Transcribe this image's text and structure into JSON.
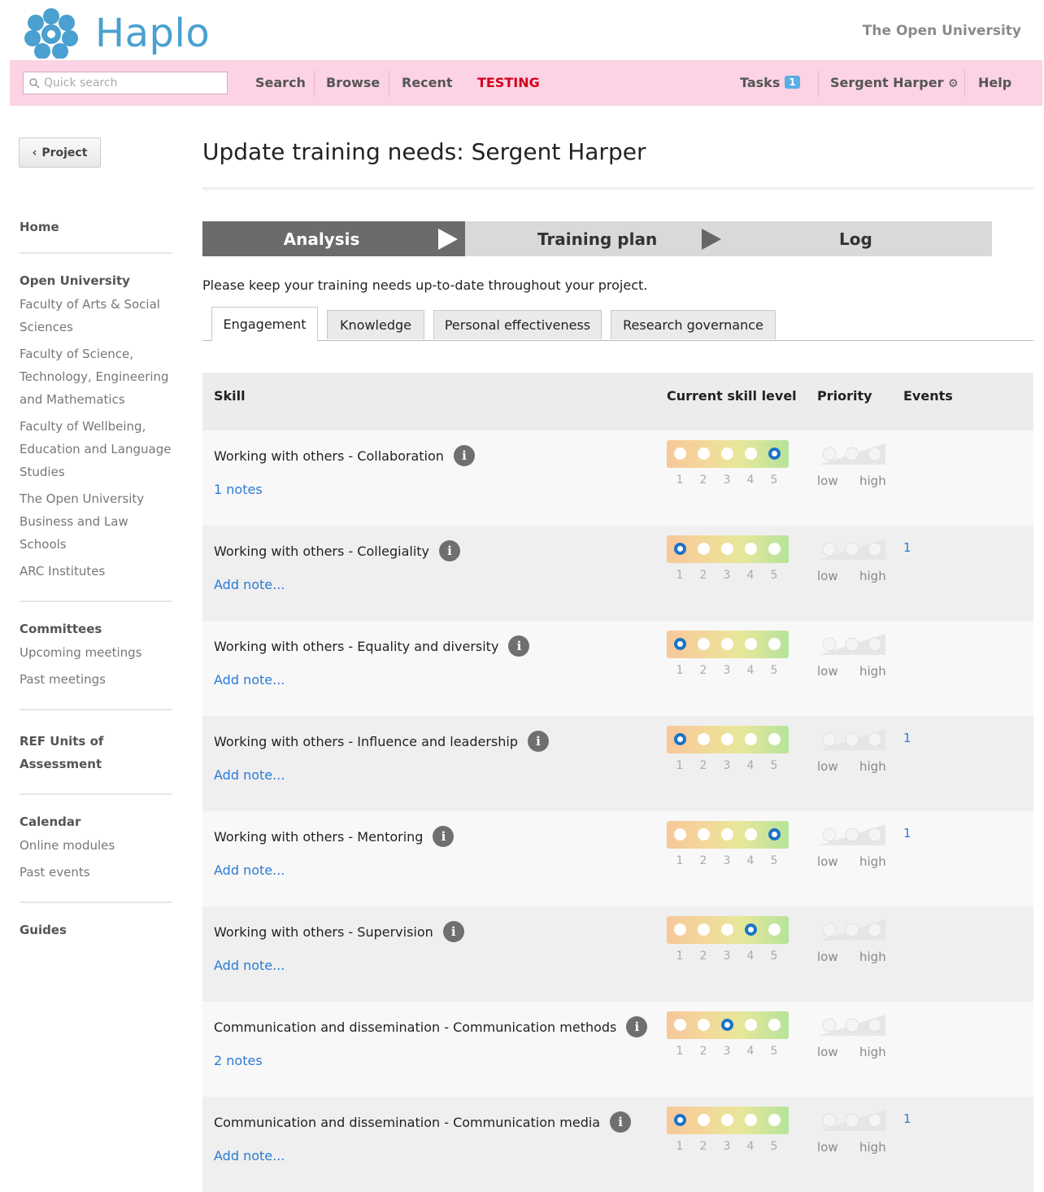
{
  "header": {
    "brand": "Haplo",
    "organisation": "The Open University"
  },
  "nav": {
    "search_placeholder": "Quick search",
    "links": [
      "Search",
      "Browse",
      "Recent",
      "TESTING"
    ],
    "tasks_label": "Tasks",
    "tasks_count": "1",
    "user": "Sergent Harper",
    "help": "Help"
  },
  "sidebar": {
    "back_label": "Project",
    "home": "Home",
    "groups": [
      {
        "heading": "Open University",
        "items": [
          "Faculty of Arts & Social Sciences",
          "Faculty of Science, Technology, Engineering and Mathematics",
          "Faculty of Wellbeing, Education and Language Studies",
          "The Open University Business and Law Schools",
          "ARC Institutes"
        ]
      },
      {
        "heading": "Committees",
        "items": [
          "Upcoming meetings",
          "Past meetings"
        ]
      },
      {
        "heading": "REF Units of Assessment",
        "items": []
      },
      {
        "heading": "Calendar",
        "items": [
          "Online modules",
          "Past events"
        ]
      }
    ],
    "guides": "Guides"
  },
  "main": {
    "title": "Update training needs: Sergent Harper",
    "steps": [
      "Analysis",
      "Training plan",
      "Log"
    ],
    "intro": "Please keep your training needs up-to-date throughout your project.",
    "tabs": [
      "Engagement",
      "Knowledge",
      "Personal effectiveness",
      "Research governance"
    ],
    "table": {
      "headers": {
        "skill": "Skill",
        "level": "Current skill level",
        "priority": "Priority",
        "events": "Events"
      },
      "level_numbers": [
        "1",
        "2",
        "3",
        "4",
        "5"
      ],
      "priority_low": "low",
      "priority_high": "high",
      "rows": [
        {
          "skill": "Working with others - Collaboration",
          "note": "1 notes",
          "level": 5,
          "events": ""
        },
        {
          "skill": "Working with others - Collegiality",
          "note": "Add note...",
          "level": 1,
          "events": "1"
        },
        {
          "skill": "Working with others - Equality and diversity",
          "note": "Add note...",
          "level": 1,
          "events": ""
        },
        {
          "skill": "Working with others - Influence and leadership",
          "note": "Add note...",
          "level": 1,
          "events": "1"
        },
        {
          "skill": "Working with others - Mentoring",
          "note": "Add note...",
          "level": 5,
          "events": "1"
        },
        {
          "skill": "Working with others - Supervision",
          "note": "Add note...",
          "level": 4,
          "events": ""
        },
        {
          "skill": "Communication and dissemination - Communication methods",
          "note": "2 notes",
          "level": 3,
          "events": ""
        },
        {
          "skill": "Communication and dissemination - Communication media",
          "note": "Add note...",
          "level": 1,
          "events": "1"
        }
      ]
    }
  },
  "colors": {
    "nav_bg": "#fbd3e4",
    "brand": "#4aa0d0",
    "testing": "#d4001a",
    "link": "#2a7bd5",
    "selected_level": "#1a73c9"
  }
}
